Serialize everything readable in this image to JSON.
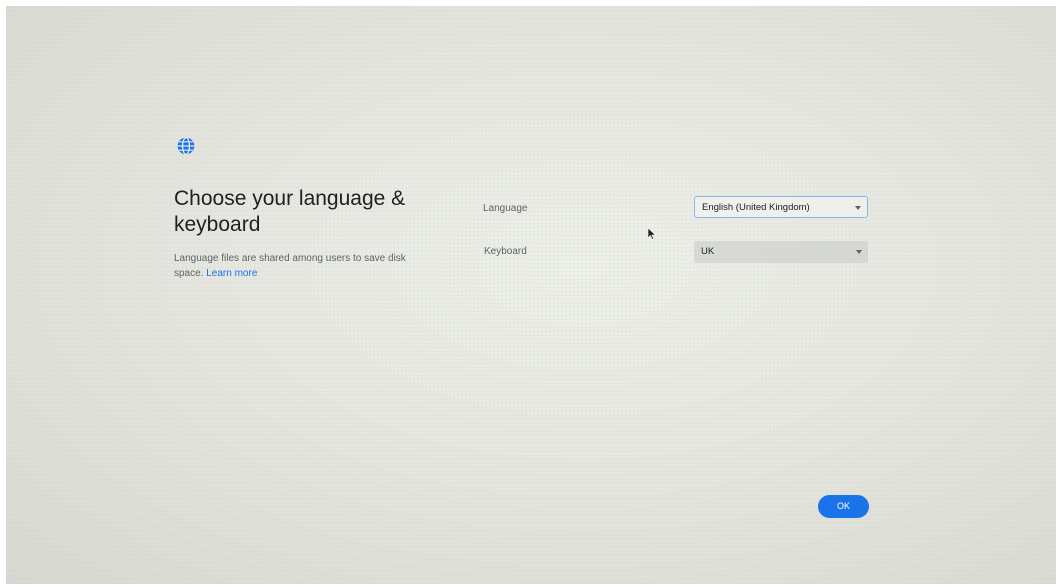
{
  "header": {
    "icon": "globe-icon",
    "title": "Choose your language & keyboard",
    "description": "Language files are shared among users to save disk space.",
    "learn_more_label": "Learn more"
  },
  "form": {
    "language_label": "Language",
    "language_value": "English (United Kingdom)",
    "keyboard_label": "Keyboard",
    "keyboard_value": "UK"
  },
  "footer": {
    "ok_label": "OK"
  },
  "colors": {
    "accent": "#1a73e8",
    "text_primary": "#202124",
    "text_secondary": "#5f6368"
  }
}
